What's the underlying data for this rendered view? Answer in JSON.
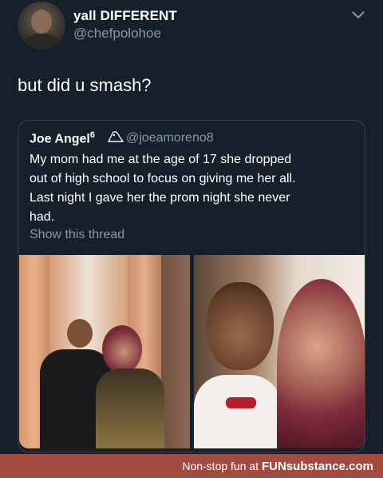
{
  "tweet": {
    "display_name": "yall DIFFERENT",
    "handle": "@chefpolohoe",
    "text": "but did u smash?"
  },
  "quoted_tweet": {
    "name": "Joe Angel",
    "superscript": "6",
    "handle": "@joeamoreno8",
    "lines": [
      "My mom had me at the age of 17 she dropped",
      "out of high school to focus on giving me her all.",
      "Last night I gave her the prom night she never",
      "had."
    ],
    "show_thread": "Show this thread"
  },
  "footer": {
    "tagline": "Non-stop fun at ",
    "brand": "FUNsubstance.com"
  },
  "colors": {
    "background": "#15202b",
    "secondary_text": "#8899a6",
    "border": "#38444d",
    "footer_bar": "#a14a3d"
  },
  "icons": [
    "owl-icon",
    "chevron-down-icon"
  ]
}
